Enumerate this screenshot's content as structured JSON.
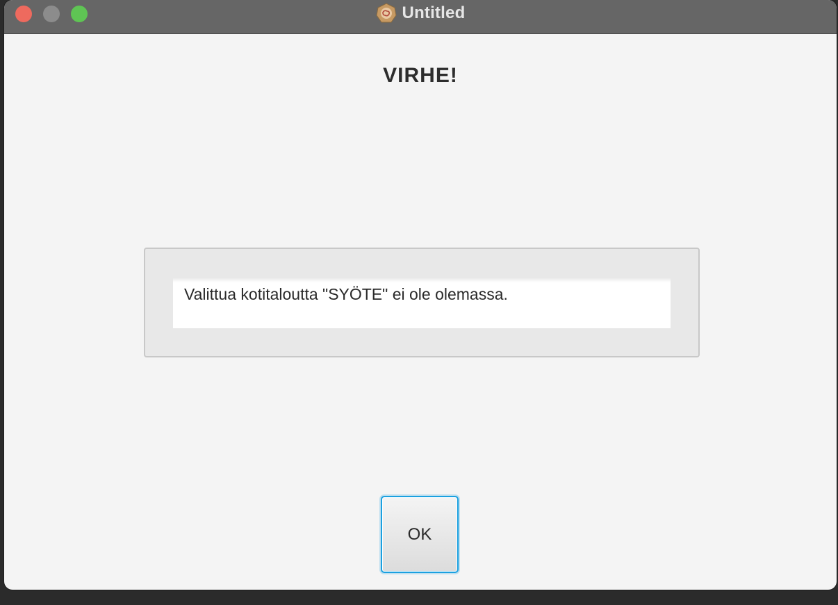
{
  "window": {
    "title": "Untitled",
    "icon": "app-icon"
  },
  "dialog": {
    "heading": "VIRHE!",
    "message": "Valittua kotitaloutta \"SYÖTE\" ei ole olemassa.",
    "ok_label": "OK"
  },
  "colors": {
    "titlebar": "#666666",
    "close": "#ee6a5e",
    "minimize": "#8c8c8c",
    "maximize": "#5fc454",
    "focus_ring": "#1aa0e0"
  }
}
